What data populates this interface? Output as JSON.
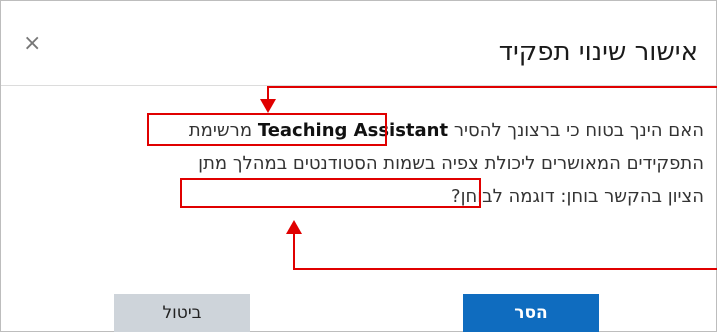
{
  "dialog": {
    "title": "אישור שינוי תפקיד",
    "close_icon": "×",
    "body": {
      "line1_prefix": "האם הינך בטוח כי ברצונך להסיר",
      "role_name": "Teaching Assistant",
      "line1_suffix": "מרשימת",
      "line2_prefix": "התפקידים המאושרים",
      "capability": "ליכולת צפיה בשמות הסטודנטים",
      "line2_suffix": "במהלך מתן",
      "line3": "הציון בהקשר בוחן: דוגמה לבוחן?"
    },
    "buttons": {
      "remove": "הסר",
      "cancel": "ביטול"
    }
  },
  "colors": {
    "primary_button": "#0f6cbf",
    "secondary_button": "#ced4da",
    "annotation": "#e00000"
  }
}
